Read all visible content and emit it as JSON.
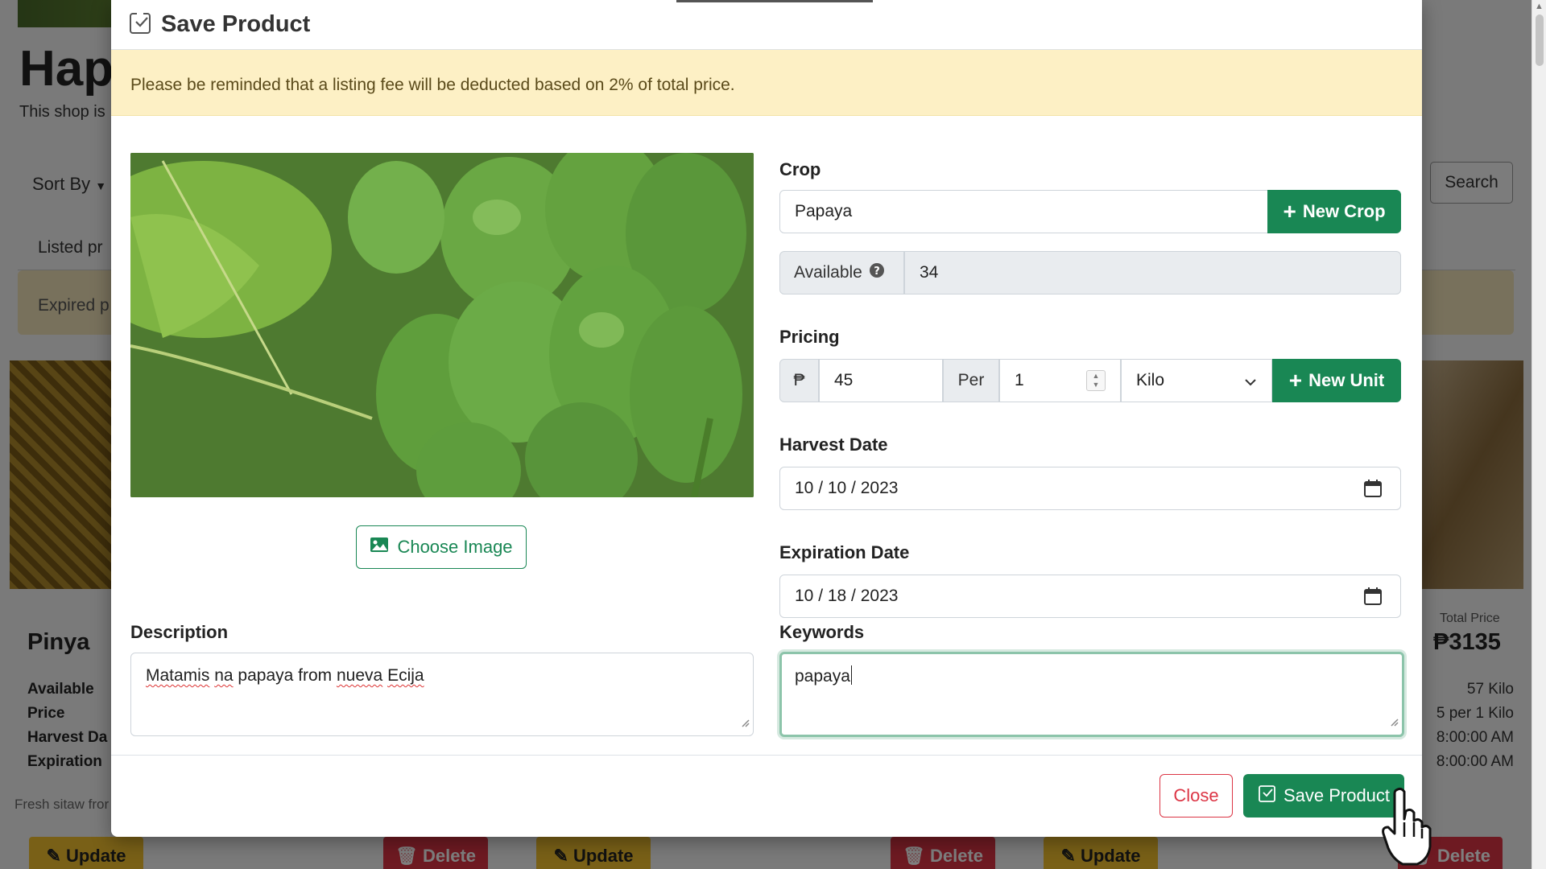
{
  "background": {
    "shop_title": "Hap",
    "shop_subtitle": "This shop is",
    "sort_label": "Sort By",
    "search_label": "Search",
    "tab_label": "Listed pr",
    "expired_label": "Expired p",
    "card": {
      "name": "Pinya",
      "labels": [
        "Available",
        "Price",
        "Harvest Da",
        "Expiration"
      ],
      "total_label": "Total Price",
      "total_value": "₱3135",
      "values": [
        "57  Kilo",
        "5 per 1 Kilo",
        "8:00:00 AM",
        "8:00:00 AM"
      ],
      "description": "Fresh sitaw fror"
    },
    "update_label": "Update",
    "delete_label": "Delete"
  },
  "modal": {
    "title": "Save Product",
    "alert": "Please be reminded that a listing fee will be deducted based on 2% of total price.",
    "choose_image_label": "Choose Image",
    "crop": {
      "label": "Crop",
      "selected": "Papaya",
      "new_crop_label": "New Crop",
      "available_label": "Available",
      "available_value": "34"
    },
    "pricing": {
      "label": "Pricing",
      "currency": "₱",
      "price": "45",
      "per_label": "Per",
      "quantity": "1",
      "unit": "Kilo",
      "new_unit_label": "New Unit"
    },
    "harvest_date": {
      "label": "Harvest Date",
      "value": "10 / 10 / 2023"
    },
    "expiration_date": {
      "label": "Expiration Date",
      "value": "10 / 18 / 2023"
    },
    "description": {
      "label": "Description",
      "words": [
        "Matamis",
        "na",
        "papaya",
        "from",
        "nueva",
        "Ecija"
      ]
    },
    "keywords": {
      "label": "Keywords",
      "value": "papaya"
    },
    "close_label": "Close",
    "save_label": "Save Product"
  },
  "colors": {
    "success": "#198754",
    "danger": "#dc3545",
    "alert_bg": "#fdf0c5",
    "warning": "#f2c12e"
  }
}
